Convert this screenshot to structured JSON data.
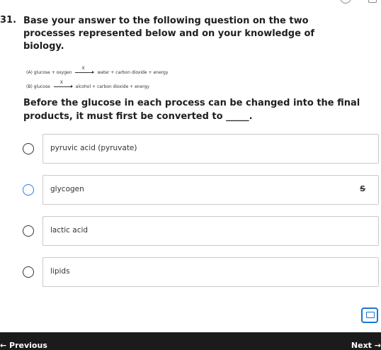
{
  "question": {
    "number": "31.",
    "text": "Base your answer to the following question on the two processes represented below and on your knowledge of biology.",
    "equations": [
      {
        "label": "(A)",
        "reactants": "glucose + oxygen",
        "catalyst": "X",
        "products": "water + carbon dioxide + energy"
      },
      {
        "label": "(B)",
        "reactants": "glucose",
        "catalyst": "X",
        "products": "alcohol + carbon dioxide + energy"
      }
    ],
    "prompt": "Before the glucose in each process can be changed into the final products, it must first be converted to _____."
  },
  "options": [
    {
      "label": "pyruvic acid (pyruvate)"
    },
    {
      "label": "glycogen",
      "strike_icon": "S"
    },
    {
      "label": "lactic acid"
    },
    {
      "label": "lipids"
    }
  ],
  "footer": {
    "previous_label": "← Previous",
    "next_label": "Next →"
  },
  "icons": {
    "notes": "notes-icon",
    "strike": "strikethrough-icon"
  },
  "colors": {
    "accent": "#1976d2",
    "footer_bg": "#1b1b1b"
  }
}
